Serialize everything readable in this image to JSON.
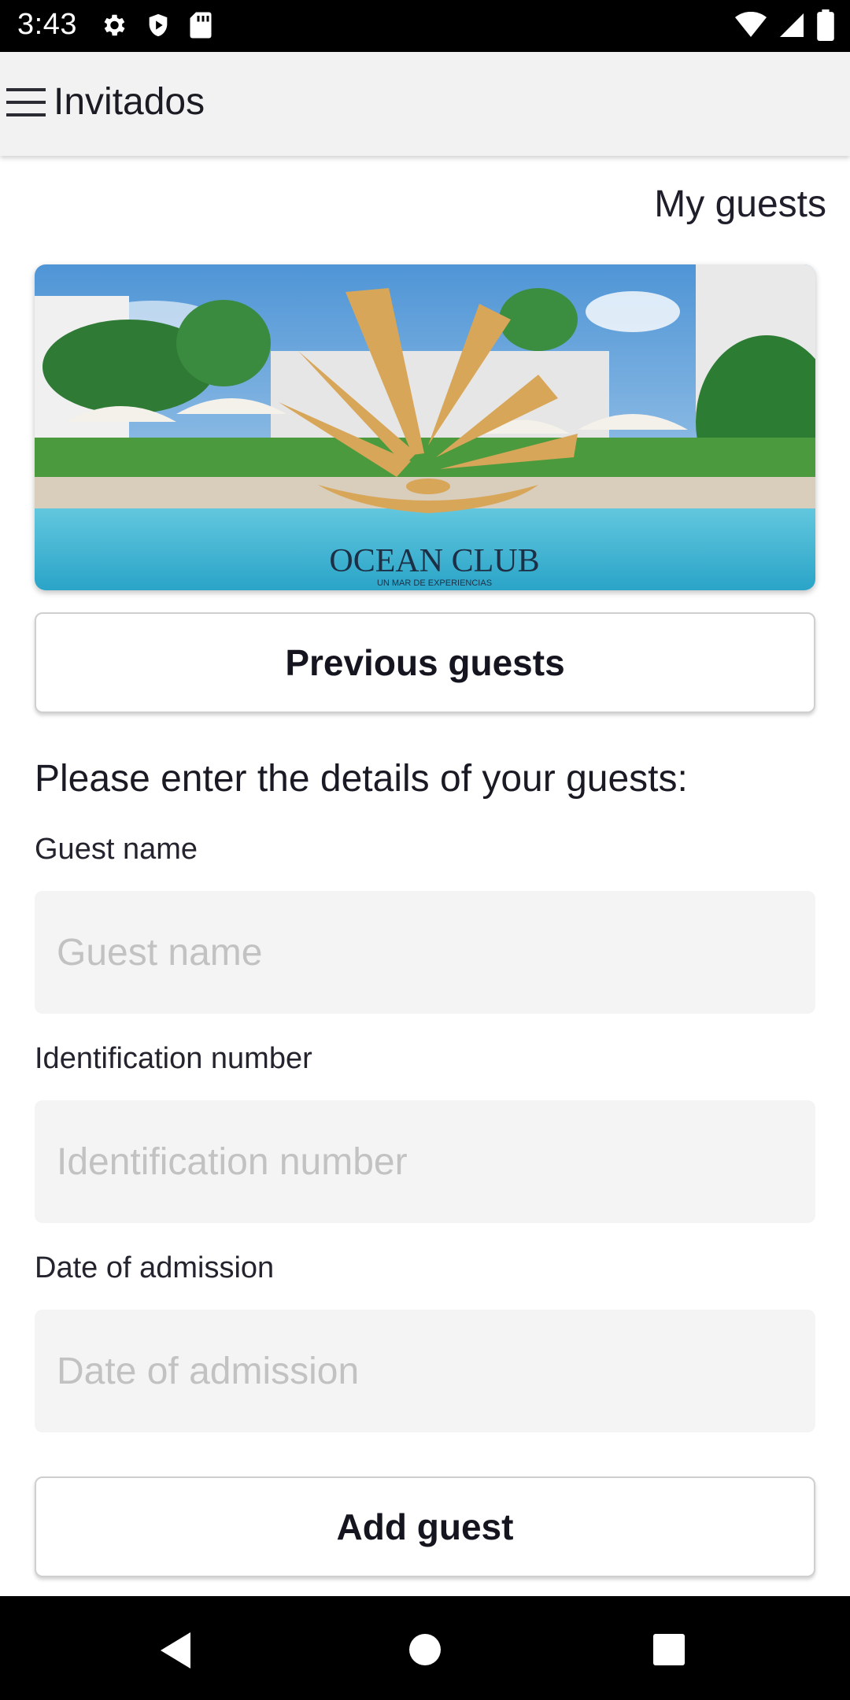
{
  "status_bar": {
    "time": "3:43",
    "left_icons": [
      "gear-icon",
      "shield-icon",
      "sd-card-icon"
    ],
    "right_icons": [
      "wifi-icon",
      "signal-icon",
      "battery-icon"
    ]
  },
  "app_bar": {
    "menu_icon": "hamburger-menu-icon",
    "title": "Invitados"
  },
  "header": {
    "section_title": "My guests"
  },
  "banner": {
    "brand": "OCEAN CLUB",
    "tagline": "UN MAR DE EXPERIENCIAS",
    "colors": {
      "gold": "#d8a659",
      "navy": "#1d2f45",
      "water": "#43b6d3"
    }
  },
  "buttons": {
    "previous_guests": "Previous guests",
    "add_guest": "Add guest"
  },
  "form": {
    "prompt": "Please enter the details of your guests:",
    "guest_name": {
      "label": "Guest name",
      "placeholder": "Guest name",
      "value": ""
    },
    "identification_number": {
      "label": "Identification number",
      "placeholder": "Identification number",
      "value": ""
    },
    "date_of_admission": {
      "label": "Date of admission",
      "placeholder": "Date of admission",
      "value": ""
    }
  },
  "nav_bar": {
    "icons": [
      "back-icon",
      "home-icon",
      "recents-icon"
    ]
  }
}
